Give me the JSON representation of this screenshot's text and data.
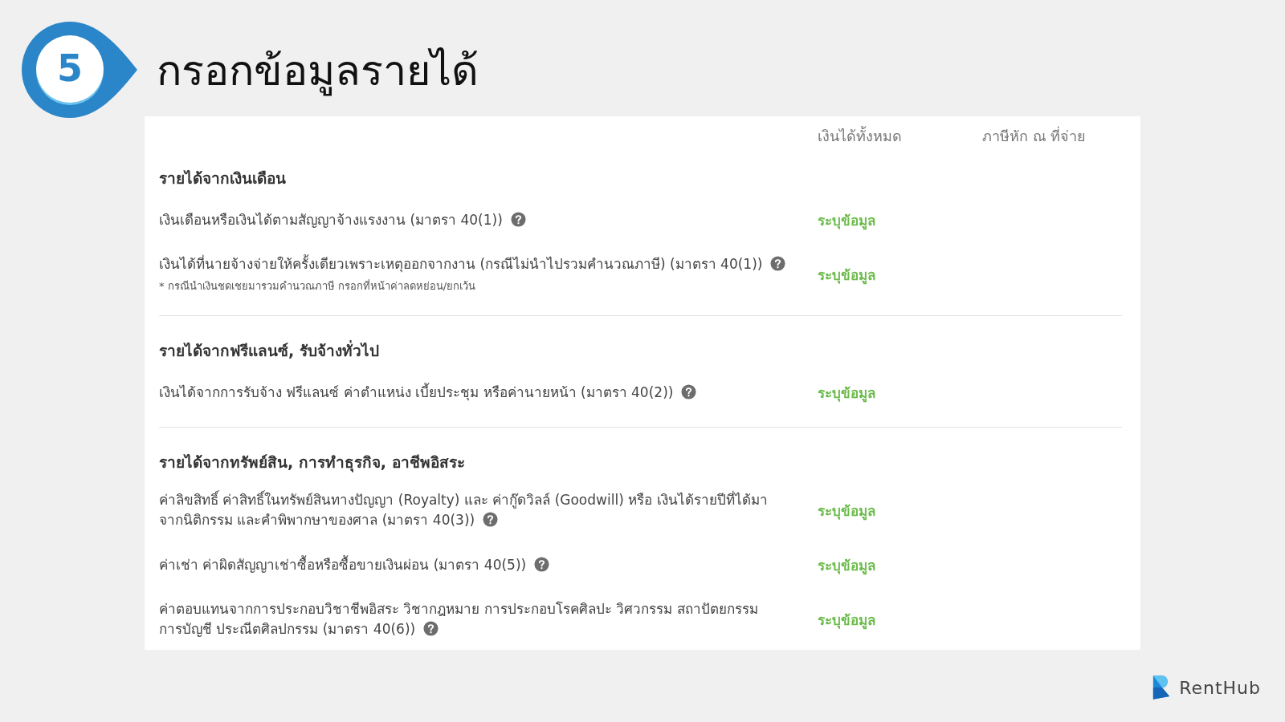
{
  "step": {
    "number": "5",
    "title": "กรอกข้อมูลรายได้"
  },
  "form": {
    "columns": [
      "เงินได้ทั้งหมด",
      "ภาษีหัก ณ ที่จ่าย"
    ],
    "sections": [
      {
        "title": "รายได้จากเงินเดือน",
        "items": [
          {
            "lines": [
              "เงินเดือนหรือเงินได้ตามสัญญาจ้างแรงงาน (มาตรา 40(1))"
            ],
            "action": "ระบุข้อมูล"
          },
          {
            "lines": [
              "เงินได้ที่นายจ้างจ่ายให้ครั้งเดียวเพราะเหตุออกจากงาน (กรณีไม่นำไปรวมคำนวณภาษี) (มาตรา 40(1))"
            ],
            "note": "* กรณีนำเงินชดเชยมารวมคำนวณภาษี กรอกที่หน้าค่าลดหย่อน/ยกเว้น",
            "action": "ระบุข้อมูล"
          }
        ]
      },
      {
        "title": "รายได้จากฟรีแลนซ์, รับจ้างทั่วไป",
        "items": [
          {
            "lines": [
              "เงินได้จากการรับจ้าง ฟรีแลนซ์ ค่าตำแหน่ง เบี้ยประชุม หรือค่านายหน้า (มาตรา 40(2))"
            ],
            "action": "ระบุข้อมูล"
          }
        ]
      },
      {
        "title": "รายได้จากทรัพย์สิน, การทำธุรกิจ, อาชีพอิสระ",
        "items": [
          {
            "lines": [
              "ค่าลิขสิทธิ์ ค่าสิทธิ์ในทรัพย์สินทางปัญญา (Royalty) และ ค่ากู๊ดวิลล์ (Goodwill) หรือ เงินได้รายปีที่ได้มา",
              "จากนิติกรรม และคำพิพากษาของศาล (มาตรา 40(3))"
            ],
            "action": "ระบุข้อมูล"
          },
          {
            "lines": [
              "ค่าเช่า ค่าผิดสัญญาเช่าซื้อหรือซื้อขายเงินผ่อน (มาตรา 40(5))"
            ],
            "action": "ระบุข้อมูล"
          },
          {
            "lines": [
              "ค่าตอบแทนจากการประกอบวิชาชีพอิสระ วิชากฎหมาย การประกอบโรคศิลปะ วิศวกรรม สถาปัตยกรรม",
              "การบัญชี ประณีตศิลปกรรม (มาตรา 40(6))"
            ],
            "action": "ระบุข้อมูล"
          }
        ]
      }
    ]
  },
  "brand": {
    "name": "RentHub"
  }
}
